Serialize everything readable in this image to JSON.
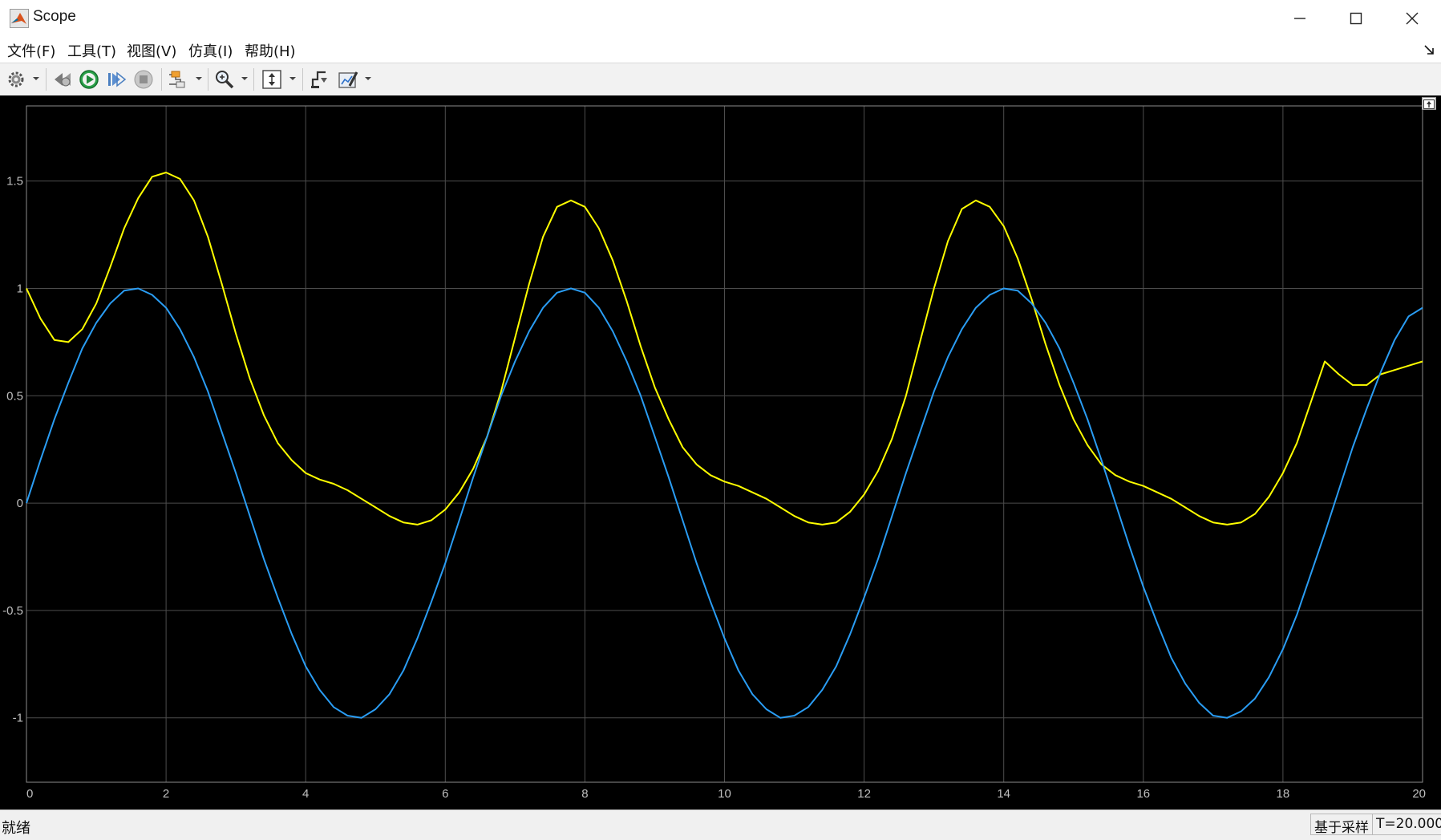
{
  "window": {
    "title": "Scope",
    "controls": [
      "minimize",
      "maximize",
      "close"
    ]
  },
  "menu": {
    "items": [
      "文件(F)",
      "工具(T)",
      "视图(V)",
      "仿真(I)",
      "帮助(H)"
    ]
  },
  "toolbar": {
    "buttons": [
      {
        "name": "settings-icon"
      },
      {
        "name": "step-back-icon"
      },
      {
        "name": "run-icon"
      },
      {
        "name": "step-forward-icon"
      },
      {
        "name": "stop-icon"
      },
      {
        "name": "highlight-simulink-icon"
      },
      {
        "name": "zoom-icon"
      },
      {
        "name": "autoscale-icon"
      },
      {
        "name": "cursor-measure-icon"
      },
      {
        "name": "style-icon"
      }
    ]
  },
  "status": {
    "left": "就绪",
    "mode": "基于采样",
    "time": "T=20.000"
  },
  "colors": {
    "plot_bg": "#000000",
    "grid": "#4d4d4d",
    "axis_text": "#bfbfbf",
    "series1": "#ffff00",
    "series2": "#2a9df4"
  },
  "chart_data": {
    "type": "line",
    "title": "",
    "xlabel": "",
    "ylabel": "",
    "xlim": [
      0,
      20
    ],
    "ylim": [
      -1.3,
      1.85
    ],
    "xticks": [
      0,
      2,
      4,
      6,
      8,
      10,
      12,
      14,
      16,
      18,
      20
    ],
    "yticks": [
      -1,
      -0.5,
      0,
      0.5,
      1,
      1.5
    ],
    "ytick_labels": [
      "-1",
      "-0.5",
      "0",
      "0.5",
      "1",
      "1.5"
    ],
    "grid": true,
    "legend": "none",
    "series": [
      {
        "color": "#ffff00",
        "x": [
          0,
          0.2,
          0.4,
          0.6,
          0.8,
          1.0,
          1.2,
          1.4,
          1.6,
          1.8,
          2.0,
          2.2,
          2.4,
          2.6,
          2.8,
          3.0,
          3.2,
          3.4,
          3.6,
          3.8,
          4.0,
          4.2,
          4.4,
          4.6,
          4.8,
          5.0,
          5.2,
          5.4,
          5.6,
          5.8,
          6.0,
          6.2,
          6.4,
          6.6,
          6.8,
          7.0,
          7.2,
          7.4,
          7.6,
          7.8,
          8.0,
          8.2,
          8.4,
          8.6,
          8.8,
          9.0,
          9.2,
          9.4,
          9.6,
          9.8,
          10.0,
          10.2,
          10.4,
          10.6,
          10.8,
          11.0,
          11.2,
          11.4,
          11.6,
          11.8,
          12.0,
          12.2,
          12.4,
          12.6,
          12.8,
          13.0,
          13.2,
          13.4,
          13.6,
          13.8,
          14.0,
          14.2,
          14.4,
          14.6,
          14.8,
          15.0,
          15.2,
          15.4,
          15.6,
          15.8,
          16.0,
          16.2,
          16.4,
          16.6,
          16.8,
          17.0,
          17.2,
          17.4,
          17.6,
          17.8,
          18.0,
          18.2,
          18.4,
          18.6,
          18.8,
          19.0,
          19.2,
          19.4,
          19.6,
          19.8,
          20.0
        ],
        "y": [
          1.0,
          0.86,
          0.76,
          0.75,
          0.81,
          0.93,
          1.1,
          1.28,
          1.42,
          1.52,
          1.54,
          1.51,
          1.41,
          1.24,
          1.02,
          0.79,
          0.58,
          0.41,
          0.28,
          0.2,
          0.14,
          0.11,
          0.09,
          0.06,
          0.02,
          -0.02,
          -0.06,
          -0.09,
          -0.1,
          -0.08,
          -0.03,
          0.05,
          0.16,
          0.31,
          0.52,
          0.77,
          1.02,
          1.24,
          1.38,
          1.41,
          1.38,
          1.28,
          1.13,
          0.94,
          0.73,
          0.54,
          0.39,
          0.26,
          0.18,
          0.13,
          0.1,
          0.08,
          0.05,
          0.02,
          -0.02,
          -0.06,
          -0.09,
          -0.1,
          -0.09,
          -0.04,
          0.04,
          0.15,
          0.3,
          0.5,
          0.75,
          1.0,
          1.22,
          1.37,
          1.41,
          1.38,
          1.29,
          1.14,
          0.95,
          0.74,
          0.55,
          0.39,
          0.27,
          0.18,
          0.13,
          0.1,
          0.08,
          0.05,
          0.02,
          -0.02,
          -0.06,
          -0.09,
          -0.1,
          -0.09,
          -0.05,
          0.03,
          0.14,
          0.28,
          0.47,
          0.66,
          0.6,
          0.55,
          0.55,
          0.6,
          0.62,
          0.64,
          0.66
        ]
      },
      {
        "color": "#2a9df4",
        "x": [
          0,
          0.2,
          0.4,
          0.6,
          0.8,
          1.0,
          1.2,
          1.4,
          1.6,
          1.8,
          2.0,
          2.2,
          2.4,
          2.6,
          2.8,
          3.0,
          3.2,
          3.4,
          3.6,
          3.8,
          4.0,
          4.2,
          4.4,
          4.6,
          4.8,
          5.0,
          5.2,
          5.4,
          5.6,
          5.8,
          6.0,
          6.2,
          6.4,
          6.6,
          6.8,
          7.0,
          7.2,
          7.4,
          7.6,
          7.8,
          8.0,
          8.2,
          8.4,
          8.6,
          8.8,
          9.0,
          9.2,
          9.4,
          9.6,
          9.8,
          10.0,
          10.2,
          10.4,
          10.6,
          10.8,
          11.0,
          11.2,
          11.4,
          11.6,
          11.8,
          12.0,
          12.2,
          12.4,
          12.6,
          12.8,
          13.0,
          13.2,
          13.4,
          13.6,
          13.8,
          14.0,
          14.2,
          14.4,
          14.6,
          14.8,
          15.0,
          15.2,
          15.4,
          15.6,
          15.8,
          16.0,
          16.2,
          16.4,
          16.6,
          16.8,
          17.0,
          17.2,
          17.4,
          17.6,
          17.8,
          18.0,
          18.2,
          18.4,
          18.6,
          18.8,
          19.0,
          19.2,
          19.4,
          19.6,
          19.8,
          20.0
        ],
        "y": [
          0.0,
          0.2,
          0.39,
          0.56,
          0.72,
          0.84,
          0.93,
          0.99,
          1.0,
          0.97,
          0.91,
          0.81,
          0.68,
          0.52,
          0.33,
          0.14,
          -0.06,
          -0.26,
          -0.44,
          -0.61,
          -0.76,
          -0.87,
          -0.95,
          -0.99,
          -1.0,
          -0.96,
          -0.89,
          -0.78,
          -0.63,
          -0.46,
          -0.28,
          -0.08,
          0.12,
          0.31,
          0.5,
          0.66,
          0.8,
          0.91,
          0.98,
          1.0,
          0.98,
          0.91,
          0.8,
          0.66,
          0.5,
          0.31,
          0.12,
          -0.08,
          -0.28,
          -0.46,
          -0.63,
          -0.78,
          -0.89,
          -0.96,
          -1.0,
          -0.99,
          -0.95,
          -0.87,
          -0.76,
          -0.61,
          -0.44,
          -0.26,
          -0.06,
          0.14,
          0.33,
          0.52,
          0.68,
          0.81,
          0.91,
          0.97,
          1.0,
          0.99,
          0.93,
          0.84,
          0.72,
          0.56,
          0.39,
          0.2,
          0.0,
          -0.2,
          -0.39,
          -0.56,
          -0.72,
          -0.84,
          -0.93,
          -0.99,
          -1.0,
          -0.97,
          -0.91,
          -0.81,
          -0.68,
          -0.52,
          -0.33,
          -0.14,
          0.06,
          0.26,
          0.44,
          0.61,
          0.76,
          0.87,
          0.91
        ]
      }
    ]
  }
}
